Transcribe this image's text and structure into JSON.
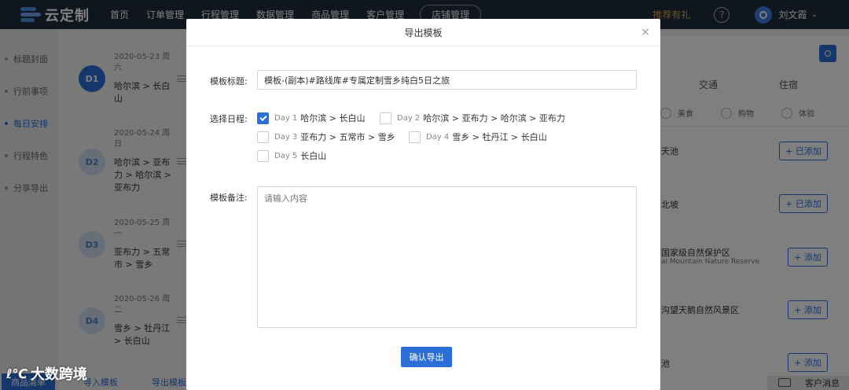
{
  "topnav": {
    "logo_text": "云定制",
    "items": [
      "首页",
      "订单管理",
      "行程管理",
      "数据管理",
      "商品管理",
      "客户管理",
      "店铺管理"
    ],
    "promo": "推荐有礼",
    "help_glyph": "?",
    "user_name": "刘文霞",
    "caret": "⌄"
  },
  "sidebar": {
    "items": [
      "标题封面",
      "行前事项",
      "每日安排",
      "行程特色",
      "分享导出"
    ],
    "active_index": 2
  },
  "days": [
    {
      "badge": "D1",
      "date": "2020-05-23 周六",
      "route": "哈尔滨 > 长白山"
    },
    {
      "badge": "D2",
      "date": "2020-05-24 周日",
      "route": "哈尔滨 > 亚布力 > 哈尔滨 > 亚布力"
    },
    {
      "badge": "D3",
      "date": "2020-05-25 周一",
      "route": "亚布力 > 五常市 > 雪乡"
    },
    {
      "badge": "D4",
      "date": "2020-05-26 周二",
      "route": "雪乡 > 牡丹江 > 长白山"
    }
  ],
  "content": {
    "columns": [
      "交通",
      "住宿"
    ],
    "filters": [
      "美食",
      "购物",
      "体验"
    ],
    "pois": [
      {
        "name": "天池",
        "sub": "",
        "button": "+ 已添加"
      },
      {
        "name": "北坡",
        "sub": "",
        "button": "+ 已添加"
      },
      {
        "name": "国家级自然保护区",
        "sub": "ai Mountain Nature Reserve",
        "button": "+ 添加"
      },
      {
        "name": "沟望天鹅自然风景区",
        "sub": "",
        "button": "+ 添加"
      },
      {
        "name": "池",
        "sub": "",
        "button": "+ 添加"
      }
    ]
  },
  "bottom": {
    "tabs": [
      "商品清单",
      "导入模板",
      "导出模板"
    ],
    "watermark": "大数跨境",
    "watermark_mark": "ℓ℃",
    "customer": "客户消息"
  },
  "modal": {
    "title": "导出模板",
    "close": "×",
    "title_label": "模板标题:",
    "title_value": "模板-(副本)#路线库#专属定制雪乡纯白5日之旅",
    "schedule_label": "选择日程:",
    "days": [
      {
        "day": "Day 1",
        "route": "哈尔滨 > 长白山",
        "checked": true
      },
      {
        "day": "Day 2",
        "route": "哈尔滨 > 亚布力 > 哈尔滨 > 亚布力",
        "checked": false
      },
      {
        "day": "Day 3",
        "route": "亚布力 > 五常市 > 雪乡",
        "checked": false
      },
      {
        "day": "Day 4",
        "route": "雪乡 > 牡丹江 > 长白山",
        "checked": false
      },
      {
        "day": "Day 5",
        "route": "长白山",
        "checked": false
      }
    ],
    "note_label": "模板备注:",
    "note_placeholder": "请输入内容",
    "confirm": "确认导出"
  },
  "colors": {
    "nav_bg": "#1f2d3d",
    "accent": "#2b6fd6",
    "promo": "#e3a340"
  }
}
